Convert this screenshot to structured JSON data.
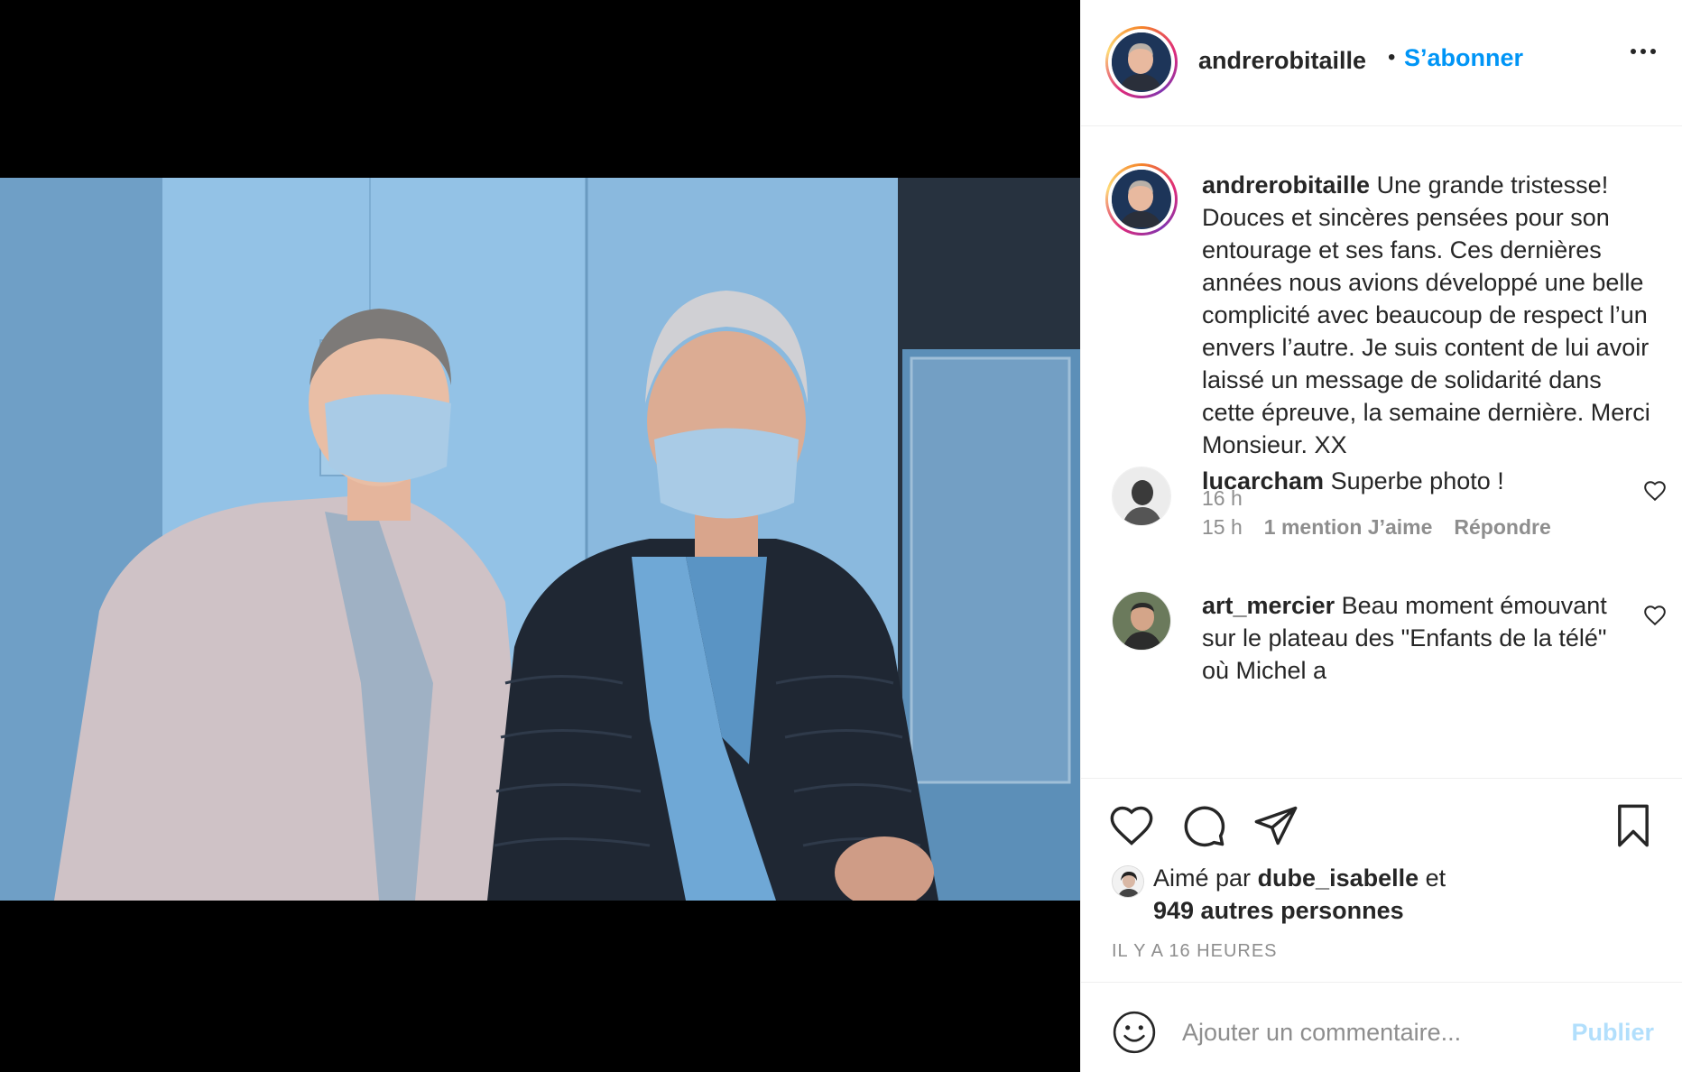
{
  "post": {
    "username": "andrerobitaille",
    "follow_label": "S’abonner",
    "separator": "•"
  },
  "caption": {
    "username": "andrerobitaille",
    "text": "Une grande tristesse! Douces et sincères pensées pour son entourage et ses fans. Ces dernières années nous avions développé une belle complicité avec beaucoup de respect l’un envers l’autre. Je suis content de lui avoir laissé un message de solidarité dans cette épreuve, la semaine dernière. Merci Monsieur. XX",
    "time": "16 h"
  },
  "comments": [
    {
      "username": "lucarcham",
      "text": "Superbe photo !",
      "time": "15 h",
      "likes": "1 mention J’aime",
      "reply": "Répondre"
    },
    {
      "username": "art_mercier",
      "text": "Beau moment émouvant sur le plateau des \"Enfants de la télé\" où Michel a"
    }
  ],
  "likes": {
    "prefix": "Aimé par",
    "user": "dube_isabelle",
    "conjunction": "et",
    "others": "949 autres personnes"
  },
  "timestamp": "IL Y A 16 HEURES",
  "add_comment": {
    "placeholder": "Ajouter un commentaire...",
    "publish_label": "Publier"
  },
  "icons": {
    "like": "heart-icon",
    "comment": "comment-icon",
    "share": "paper-plane-icon",
    "save": "bookmark-icon",
    "emoji": "emoji-smiley-icon",
    "more": "more-options-icon",
    "comment_like": "small-heart-icon"
  },
  "colors": {
    "accent": "#0095f6",
    "publish_disabled": "#b2dffc",
    "secondary_text": "#8e8e8e"
  }
}
